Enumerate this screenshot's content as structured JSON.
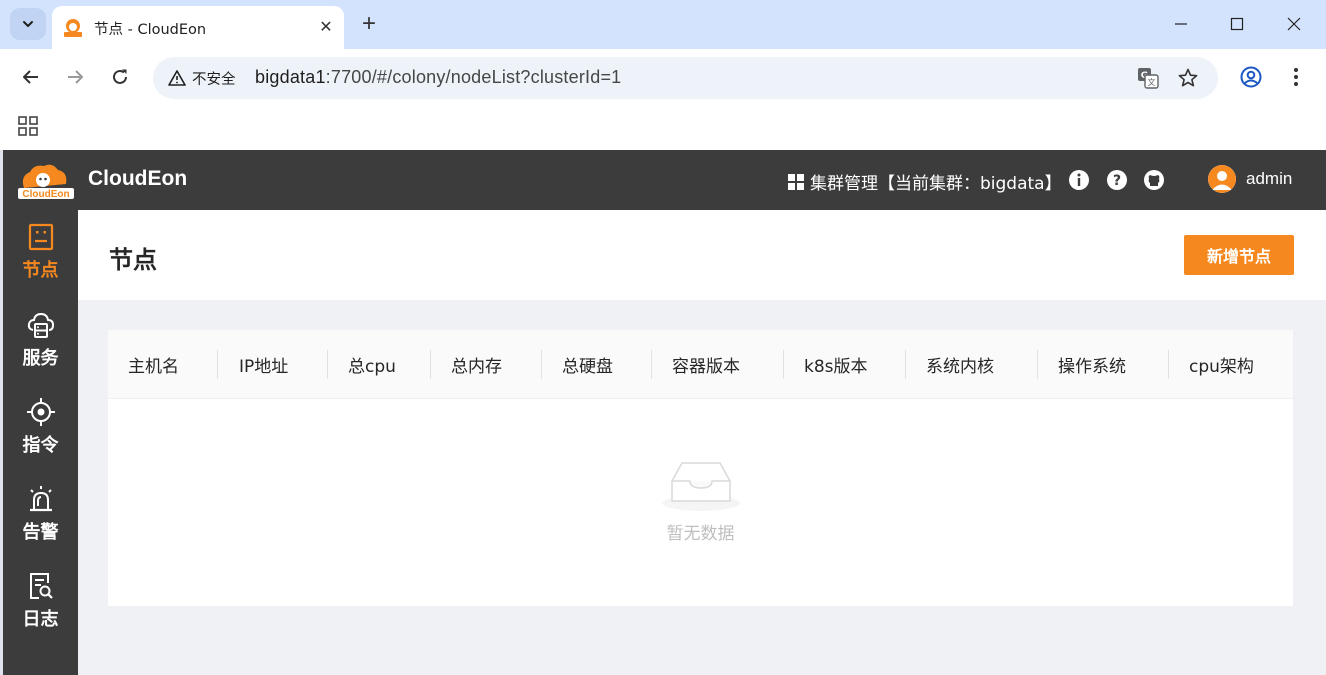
{
  "browser": {
    "tab_title": "节点 - CloudEon",
    "security_label": "不安全",
    "url_host": "bigdata1",
    "url_path": ":7700/#/colony/nodeList?clusterId=1"
  },
  "header": {
    "brand": "CloudEon",
    "logo_text": "CloudEon",
    "cluster_label": "集群管理【当前集群：bigdata】",
    "username": "admin"
  },
  "sidebar": {
    "items": [
      {
        "label": "节点",
        "icon": "node-icon",
        "active": true
      },
      {
        "label": "服务",
        "icon": "service-icon",
        "active": false
      },
      {
        "label": "指令",
        "icon": "command-icon",
        "active": false
      },
      {
        "label": "告警",
        "icon": "alarm-icon",
        "active": false
      },
      {
        "label": "日志",
        "icon": "log-icon",
        "active": false
      }
    ]
  },
  "page": {
    "title": "节点",
    "add_button": "新增节点"
  },
  "table": {
    "columns": [
      "主机名",
      "IP地址",
      "总cpu",
      "总内存",
      "总硬盘",
      "容器版本",
      "k8s版本",
      "系统内核",
      "操作系统",
      "cpu架构"
    ],
    "empty_text": "暂无数据"
  },
  "colors": {
    "accent": "#f5881f",
    "header_bg": "#3c3c3c",
    "chrome_bg": "#d3e3fd"
  }
}
